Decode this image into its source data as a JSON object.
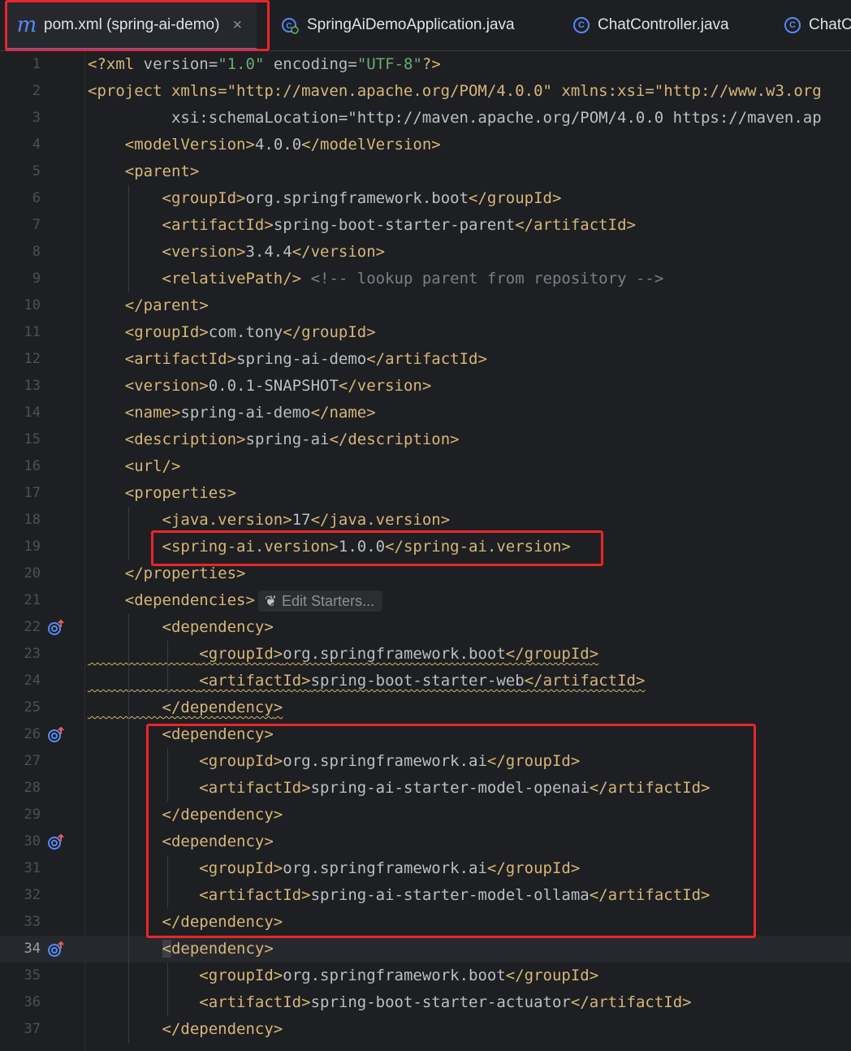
{
  "tabs": [
    {
      "label": "pom.xml (spring-ai-demo)",
      "icon": "maven-m-icon",
      "active": true
    },
    {
      "label": "SpringAiDemoApplication.java",
      "icon": "spring-boot-class-icon",
      "active": false
    },
    {
      "label": "ChatController.java",
      "icon": "class-icon",
      "active": false
    },
    {
      "label": "ChatC",
      "icon": "class-icon",
      "active": false
    }
  ],
  "tab_icon_glyphs": {
    "maven": "m",
    "class": "C"
  },
  "editor": {
    "edit_starters_label": "Edit Starters...",
    "lines": [
      {
        "n": "1",
        "text": "<?xml version=\"1.0\" encoding=\"UTF-8\"?>"
      },
      {
        "n": "2",
        "text": "<project xmlns=\"http://maven.apache.org/POM/4.0.0\" xmlns:xsi=\"http://www.w3.org"
      },
      {
        "n": "3",
        "text": "         xsi:schemaLocation=\"http://maven.apache.org/POM/4.0.0 https://maven.ap"
      },
      {
        "n": "4",
        "text": "    <modelVersion>4.0.0</modelVersion>"
      },
      {
        "n": "5",
        "text": "    <parent>"
      },
      {
        "n": "6",
        "text": "        <groupId>org.springframework.boot</groupId>"
      },
      {
        "n": "7",
        "text": "        <artifactId>spring-boot-starter-parent</artifactId>"
      },
      {
        "n": "8",
        "text": "        <version>3.4.4</version>"
      },
      {
        "n": "9",
        "text": "        <relativePath/> <!-- lookup parent from repository -->"
      },
      {
        "n": "10",
        "text": "    </parent>"
      },
      {
        "n": "11",
        "text": "    <groupId>com.tony</groupId>"
      },
      {
        "n": "12",
        "text": "    <artifactId>spring-ai-demo</artifactId>"
      },
      {
        "n": "13",
        "text": "    <version>0.0.1-SNAPSHOT</version>"
      },
      {
        "n": "14",
        "text": "    <name>spring-ai-demo</name>"
      },
      {
        "n": "15",
        "text": "    <description>spring-ai</description>"
      },
      {
        "n": "16",
        "text": "    <url/>"
      },
      {
        "n": "17",
        "text": "    <properties>"
      },
      {
        "n": "18",
        "text": "        <java.version>17</java.version>"
      },
      {
        "n": "19",
        "text": "        <spring-ai.version>1.0.0</spring-ai.version>"
      },
      {
        "n": "20",
        "text": "    </properties>"
      },
      {
        "n": "21",
        "text": "    <dependencies>"
      },
      {
        "n": "22",
        "text": "        <dependency>"
      },
      {
        "n": "23",
        "text": "            <groupId>org.springframework.boot</groupId>"
      },
      {
        "n": "24",
        "text": "            <artifactId>spring-boot-starter-web</artifactId>"
      },
      {
        "n": "25",
        "text": "        </dependency>"
      },
      {
        "n": "26",
        "text": "        <dependency>"
      },
      {
        "n": "27",
        "text": "            <groupId>org.springframework.ai</groupId>"
      },
      {
        "n": "28",
        "text": "            <artifactId>spring-ai-starter-model-openai</artifactId>"
      },
      {
        "n": "29",
        "text": "        </dependency>"
      },
      {
        "n": "30",
        "text": "        <dependency>"
      },
      {
        "n": "31",
        "text": "            <groupId>org.springframework.ai</groupId>"
      },
      {
        "n": "32",
        "text": "            <artifactId>spring-ai-starter-model-ollama</artifactId>"
      },
      {
        "n": "33",
        "text": "        </dependency>"
      },
      {
        "n": "34",
        "text": "        <dependency>"
      },
      {
        "n": "35",
        "text": "            <groupId>org.springframework.boot</groupId>"
      },
      {
        "n": "36",
        "text": "            <artifactId>spring-boot-starter-actuator</artifactId>"
      },
      {
        "n": "37",
        "text": "        </dependency>"
      }
    ],
    "current_line": "34",
    "gutter_icon_lines": [
      "22",
      "26",
      "30",
      "34"
    ],
    "warning_lines": [
      "23",
      "24",
      "25"
    ]
  },
  "colors": {
    "background": "#1e1f22",
    "tag": "#d5b778",
    "string": "#6aab73",
    "namespace": "#c77dbb",
    "comment": "#7a7e85",
    "highlight_box": "#e8262a",
    "accent": "#3574f0"
  }
}
